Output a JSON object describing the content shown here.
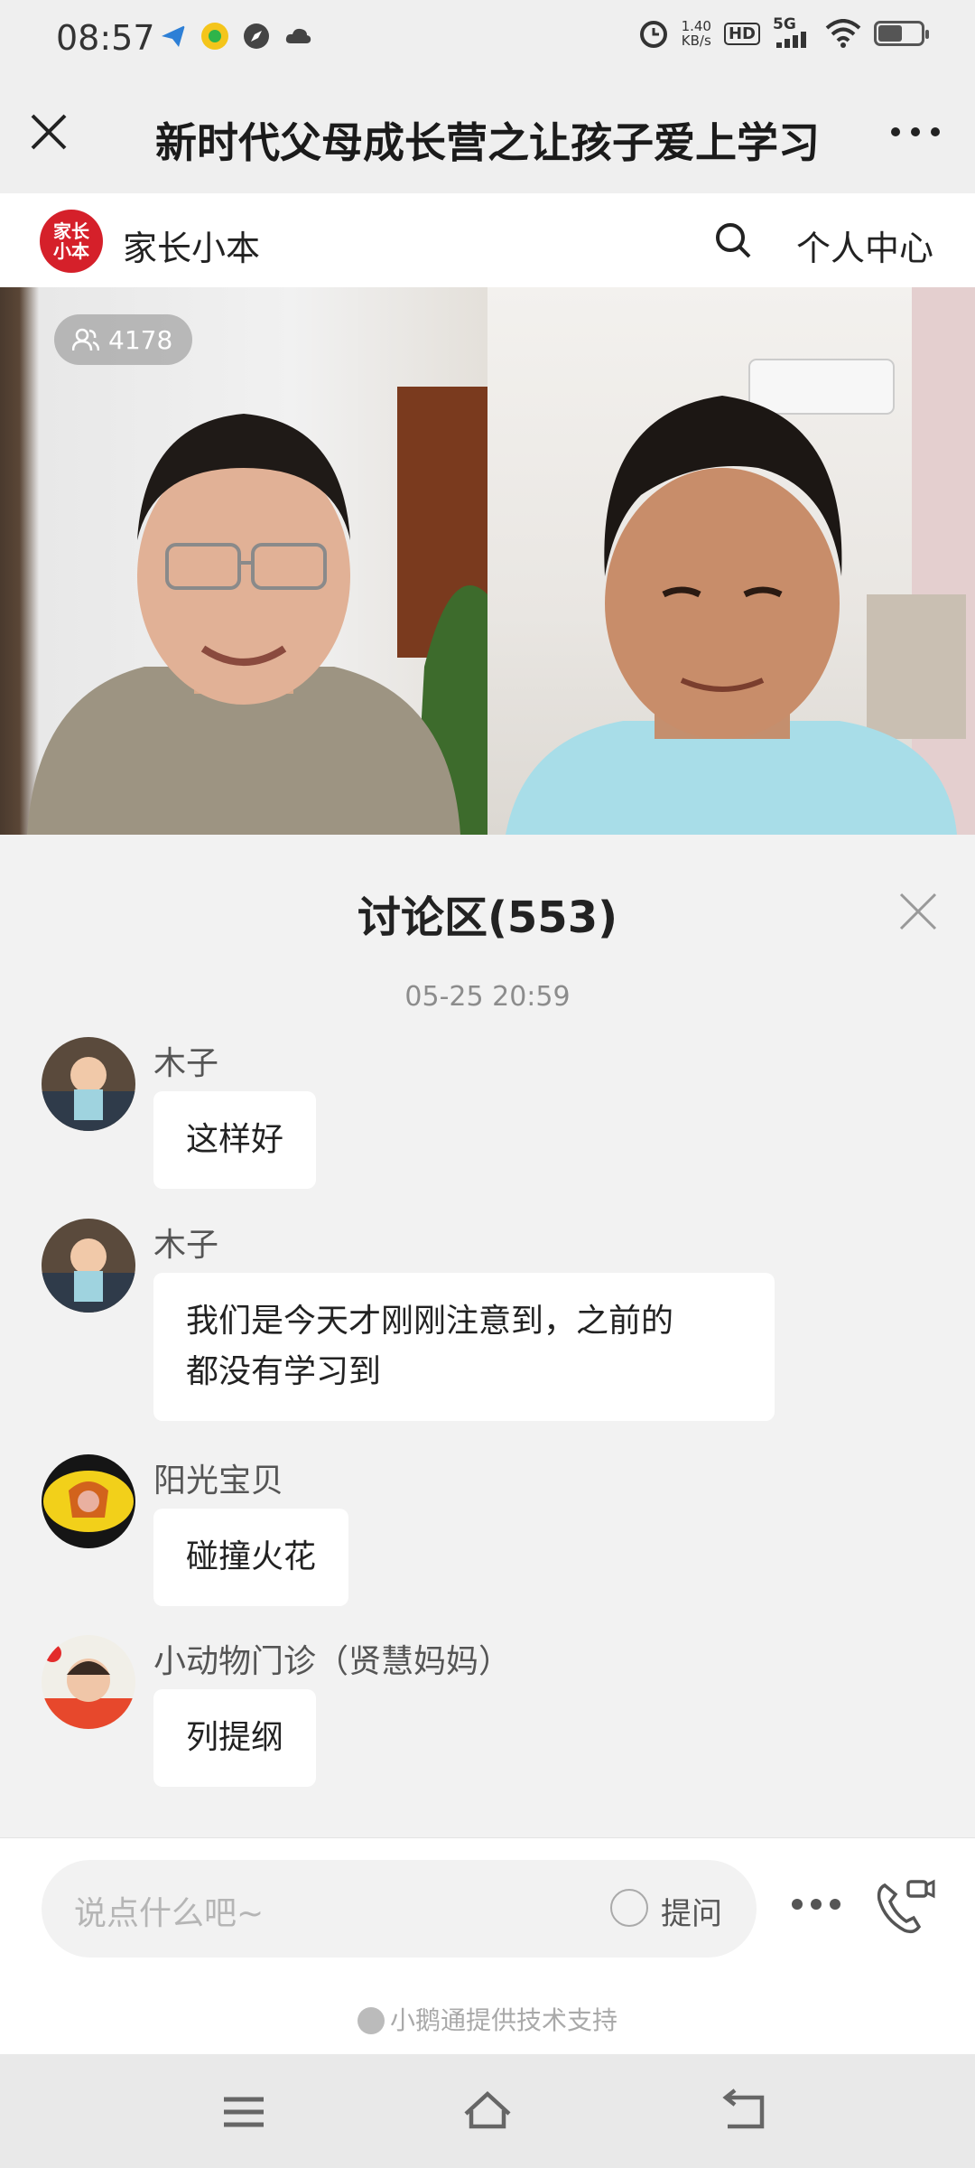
{
  "status_bar": {
    "time": "08:57",
    "speed_value": "1.40",
    "speed_unit": "KB/s",
    "hd_badge": "HD",
    "network": "5G",
    "battery_level": 0.6
  },
  "header": {
    "title": "新时代父母成长营之让孩子爱上学习"
  },
  "brand_bar": {
    "logo_text": "家长小本",
    "name": "家长小本",
    "personal_center": "个人中心"
  },
  "video": {
    "viewer_count": "4178"
  },
  "discussion": {
    "title": "讨论区(553)",
    "timestamp": "05-25 20:59",
    "messages": [
      {
        "user": "木子",
        "text": "这样好"
      },
      {
        "user": "木子",
        "text_line1": "我们是今天才刚刚注意到，之前的",
        "text_line2": "都没有学习到"
      },
      {
        "user": "阳光宝贝",
        "text": "碰撞火花"
      },
      {
        "user": "小动物门诊（贤慧妈妈）",
        "text": "列提纲"
      }
    ]
  },
  "input_bar": {
    "placeholder": "说点什么吧~",
    "ask_label": "提问",
    "powered_by": "小鹅通提供技术支持"
  },
  "colors": {
    "brand_red": "#d5202a",
    "background": "#f2f2f2"
  }
}
